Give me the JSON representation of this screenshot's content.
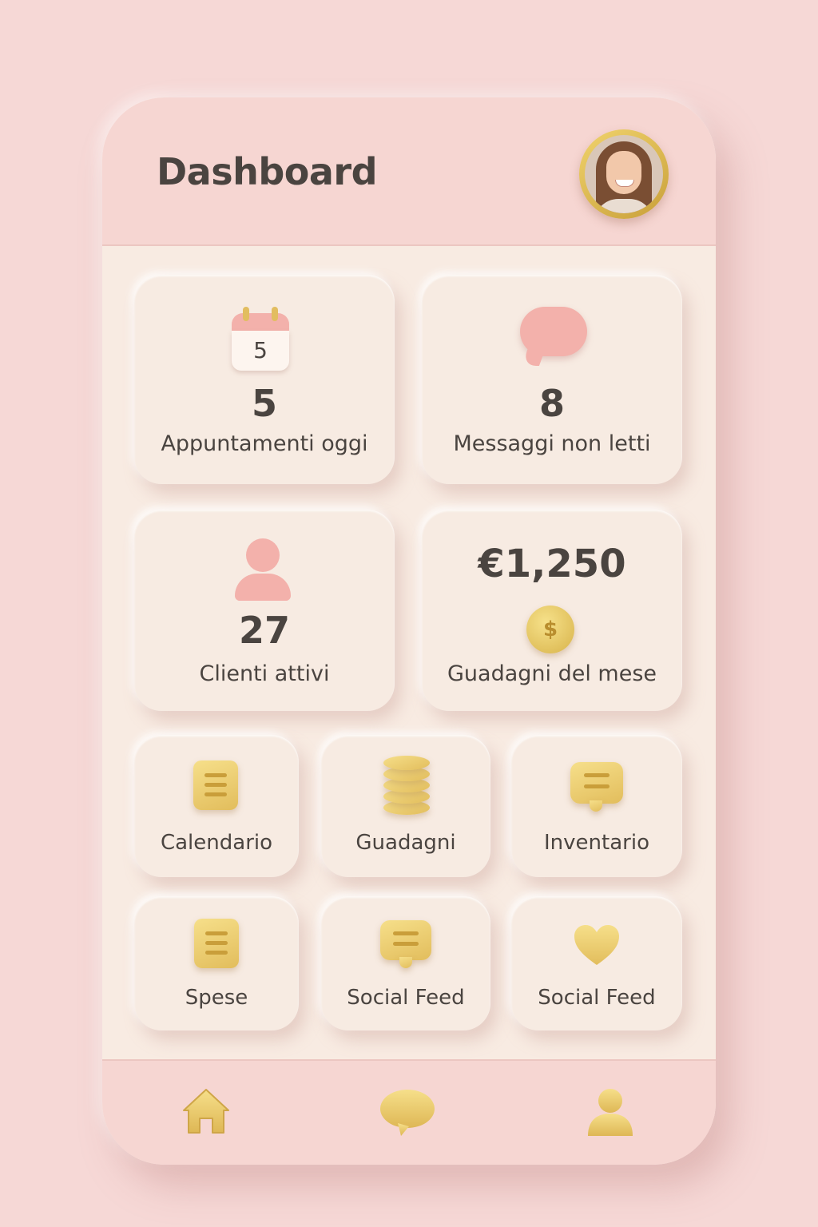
{
  "header": {
    "title": "Dashboard"
  },
  "stats": [
    {
      "icon": "calendar-icon",
      "icon_text": "5",
      "value": "5",
      "label": "Appuntamenti oggi"
    },
    {
      "icon": "chat-bubble-icon",
      "value": "8",
      "label": "Messaggi non letti"
    },
    {
      "icon": "person-icon",
      "value": "27",
      "label": "Clienti attivi"
    },
    {
      "icon": "coin-icon",
      "icon_text": "$",
      "value": "€1,250",
      "label": "Guadagni del mese"
    }
  ],
  "tiles": [
    {
      "icon": "document-icon",
      "label": "Calendario"
    },
    {
      "icon": "coin-stack-icon",
      "label": "Guadagni"
    },
    {
      "icon": "message-icon",
      "label": "Inventario"
    },
    {
      "icon": "document-icon",
      "label": "Spese"
    },
    {
      "icon": "message-icon",
      "label": "Social Feed"
    },
    {
      "icon": "heart-icon",
      "label": "Social Feed"
    }
  ],
  "bottom_nav": [
    {
      "icon": "home-icon"
    },
    {
      "icon": "chat-icon"
    },
    {
      "icon": "profile-icon"
    }
  ],
  "colors": {
    "background": "#f6d8d6",
    "card": "#f7ebe2",
    "header": "#f6d6d2",
    "accent_pink": "#f3b1ab",
    "accent_gold": "#e2bd5c",
    "text": "#4a4440"
  }
}
